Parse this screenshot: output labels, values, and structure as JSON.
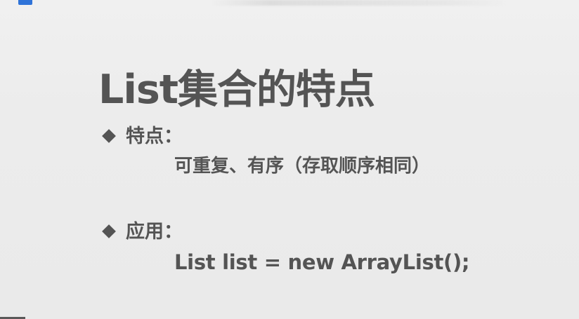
{
  "slide": {
    "title": "List集合的特点",
    "sections": [
      {
        "label": "特点：",
        "body": "可重复、有序（存取顺序相同）"
      },
      {
        "label": "应用：",
        "body": "List list = new ArrayList();"
      }
    ]
  },
  "colors": {
    "background": "#ebebeb",
    "text": "#545454",
    "accent": "#2f73d8"
  }
}
